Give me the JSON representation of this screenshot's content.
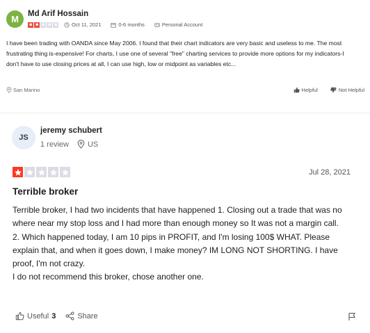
{
  "review1": {
    "avatar_initial": "M",
    "avatar_color": "#7cb342",
    "author": "Md Arif Hossain",
    "rating": 2,
    "rating_color": "#e84a3f",
    "date": "Oct 11, 2021",
    "duration": "0-6 months",
    "account_type": "Personal Account",
    "body": "I have been trading with OANDA since May 2006. I found that their chart indicators are very basic and useless to me. The most frustrating thing is-expensive! For charts, I use one of several \"free\" charting services to provide more options for my indicators-I don't have to use closing prices at all, I can use high, low or midpoint as variables etc...",
    "location": "San Marino",
    "helpful_label": "Helpful",
    "not_helpful_label": "Not Helpful"
  },
  "review2": {
    "avatar_initials": "JS",
    "author": "jeremy schubert",
    "review_count": "1 review",
    "country": "US",
    "rating": 1,
    "rating_color": "#ff3722",
    "date": "Jul 28, 2021",
    "title": "Terrible broker",
    "paragraphs": [
      "Terrible broker, I had two incidents that have happened 1. Closing out a trade that was no where near my stop loss and I had more than enough money so It was not a margin call.",
      "2. Which happened today, I am 10 pips in PROFIT, and I'm losing 100$ WHAT. Please explain that, and when it goes down, I make money? IM LONG NOT SHORTING. I have proof, I'm not crazy.",
      "I do not recommend this broker, chose another one."
    ],
    "useful_label": "Useful",
    "useful_count": "3",
    "share_label": "Share"
  }
}
